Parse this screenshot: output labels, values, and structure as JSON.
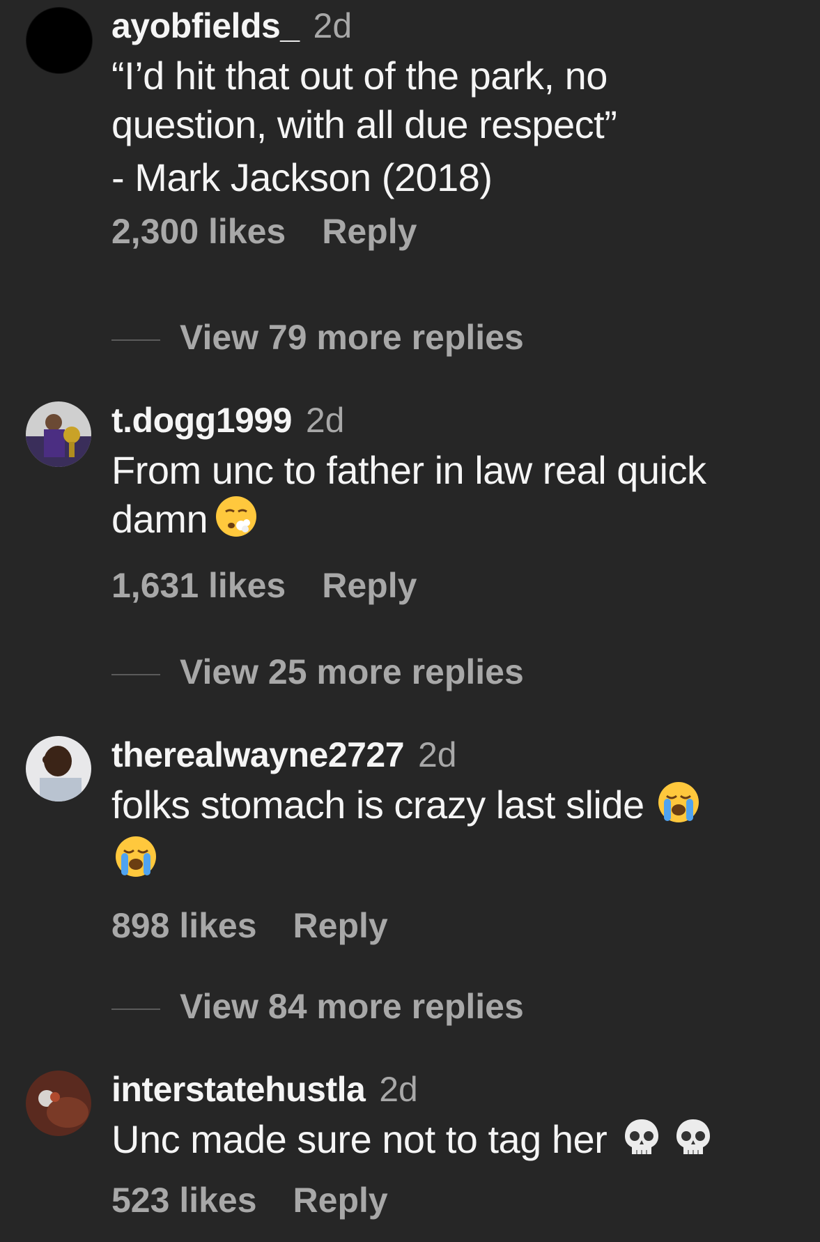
{
  "comments": [
    {
      "username": "ayobfields_",
      "time": "2d",
      "text_lines": [
        "“I’d hit that out of the park, no",
        "question, with all due respect”"
      ],
      "attribution": "- Mark Jackson (2018)",
      "likes": "2,300 likes",
      "reply": "Reply",
      "view_more": "View 79 more replies"
    },
    {
      "username": "t.dogg1999",
      "time": "2d",
      "text_lines": [
        "From unc to father in law real quick",
        "damn"
      ],
      "emoji": "face-exhaling-emoji",
      "likes": "1,631 likes",
      "reply": "Reply",
      "view_more": "View 25 more replies"
    },
    {
      "username": "therealwayne2727",
      "time": "2d",
      "text_lines": [
        "folks stomach is crazy last slide"
      ],
      "emoji": "loudly-crying-emoji",
      "likes": "898 likes",
      "reply": "Reply",
      "view_more": "View 84 more replies"
    },
    {
      "username": "interstatehustla",
      "time": "2d",
      "text_lines": [
        "Unc made sure not to tag her"
      ],
      "emoji": "skull-emoji",
      "likes": "523 likes",
      "reply": "Reply"
    }
  ],
  "colors": {
    "background": "#262626",
    "primary_text": "#f5f5f5",
    "secondary_text": "#a8a8a8"
  }
}
